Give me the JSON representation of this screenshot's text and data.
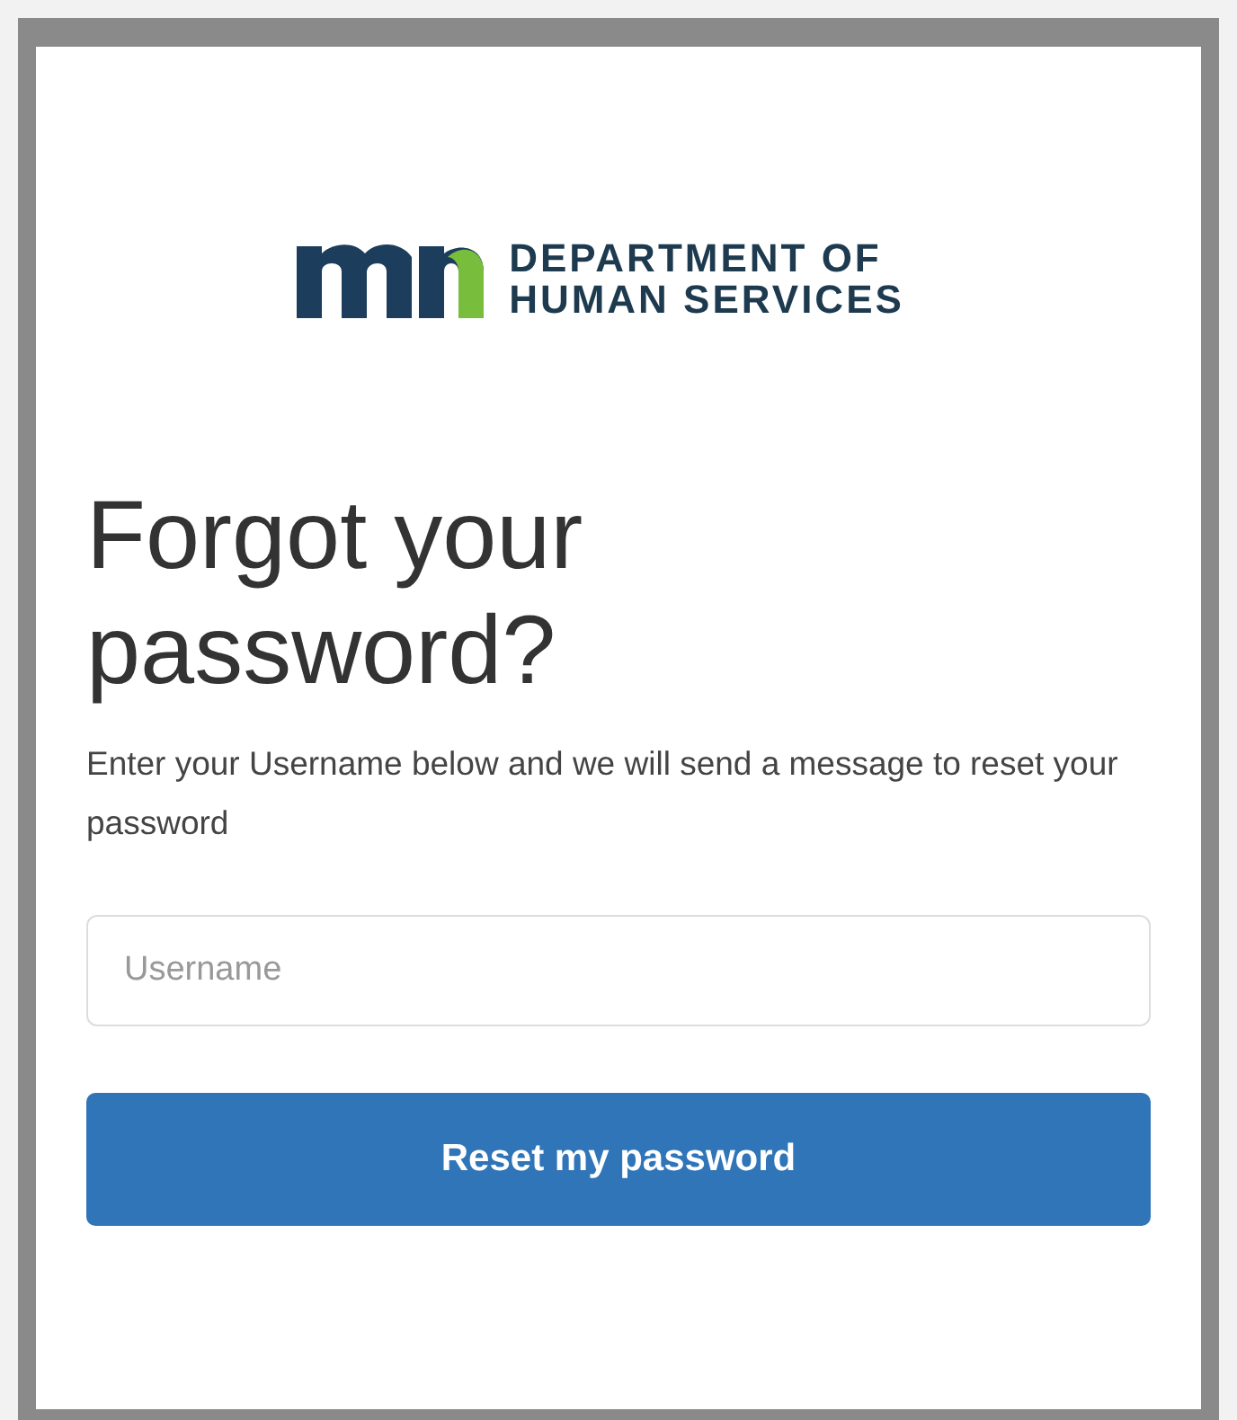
{
  "logo": {
    "lines": [
      "DEPARTMENT OF",
      "HUMAN SERVICES"
    ]
  },
  "heading": "Forgot your password?",
  "instructions": "Enter your Username below and we will send a message to reset your password",
  "username_field": {
    "placeholder": "Username"
  },
  "submit_button": "Reset my password"
}
